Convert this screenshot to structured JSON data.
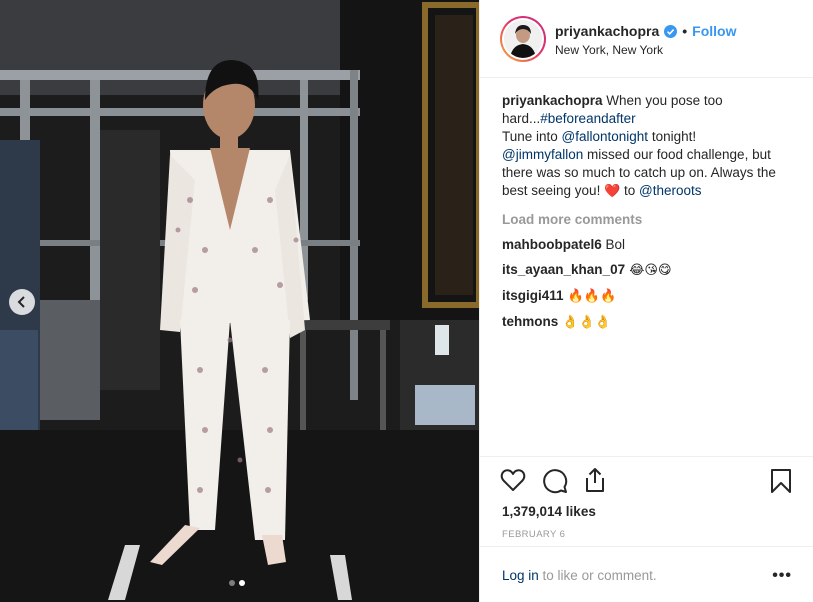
{
  "post": {
    "username": "priyankachopra",
    "location": "New York, New York",
    "follow_label": "Follow",
    "separator": "•"
  },
  "caption": {
    "username": "priyankachopra",
    "text1": " When you pose too hard...",
    "hashtag": "#beforeandafter",
    "text2": "Tune into ",
    "mention1": "@fallontonight",
    "text3": " tonight! ",
    "mention2": "@jimmyfallon",
    "text4": " missed our food challenge, but there was so much to catch up on. Always the best seeing you! ",
    "heart": "❤️",
    "text5": " to ",
    "mention3": "@theroots"
  },
  "load_more": "Load more comments",
  "comments": [
    {
      "username": "mahboobpatel6",
      "text": " Bol"
    },
    {
      "username": "its_ayaan_khan_07",
      "text": " 😂😘😋"
    },
    {
      "username": "itsgigi411",
      "text": " 🔥🔥🔥"
    },
    {
      "username": "tehmons",
      "text": " 👌👌👌"
    }
  ],
  "likes": "1,379,014 likes",
  "date": "FEBRUARY 6",
  "footer": {
    "login_link": "Log in",
    "login_rest": " to like or comment.",
    "more": "•••"
  },
  "carousel": {
    "current": 2,
    "total": 2
  },
  "colors": {
    "accent": "#3897f0",
    "link": "#003569",
    "muted": "#999999",
    "heart": "#e0102e"
  },
  "icons": [
    "verified-badge-icon",
    "heart-icon",
    "comment-icon",
    "share-icon",
    "bookmark-icon",
    "chevron-left-icon",
    "more-icon"
  ]
}
